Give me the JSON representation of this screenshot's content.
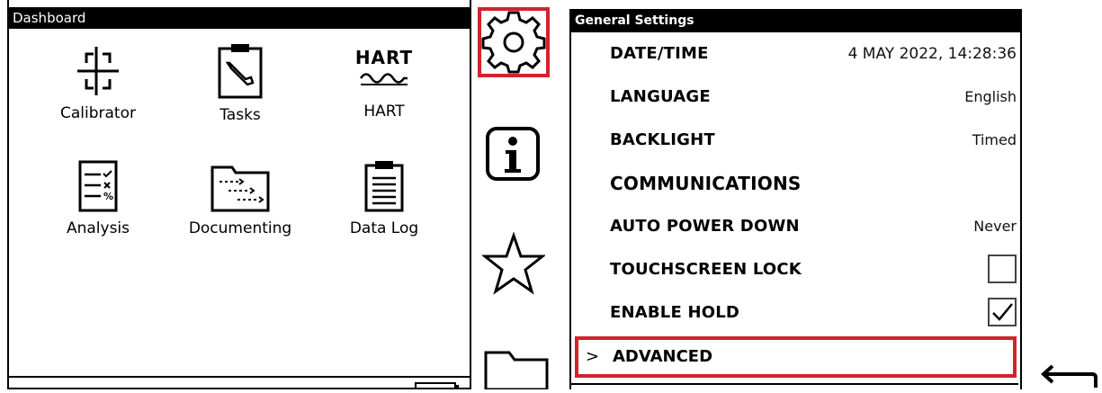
{
  "dashboard": {
    "title": "Dashboard",
    "apps": [
      {
        "label": "Calibrator",
        "icon": "crosshair-calibrator-icon"
      },
      {
        "label": "Tasks",
        "icon": "clipboard-wrench-icon"
      },
      {
        "label": "HART",
        "icon": "hart-wave-icon",
        "icon_text": "HART"
      },
      {
        "label": "Analysis",
        "icon": "analysis-list-icon"
      },
      {
        "label": "Documenting",
        "icon": "documenting-folder-icon"
      },
      {
        "label": "Data Log",
        "icon": "data-log-clipboard-icon"
      }
    ]
  },
  "side_strip": {
    "icons": [
      "settings-gear-icon",
      "info-icon",
      "favorites-star-icon",
      "folder-icon"
    ],
    "selected": "settings-gear-icon",
    "highlight_color": "#d0242b"
  },
  "general_settings": {
    "title": "General Settings",
    "rows": [
      {
        "label": "DATE/TIME",
        "value": "4 MAY 2022, 14:28:36"
      },
      {
        "label": "LANGUAGE",
        "value": "English"
      },
      {
        "label": "BACKLIGHT",
        "value": "Timed"
      },
      {
        "label": "COMMUNICATIONS",
        "value": ""
      },
      {
        "label": "AUTO POWER DOWN",
        "value": "Never"
      },
      {
        "label": "TOUCHSCREEN LOCK",
        "checked": false
      },
      {
        "label": "ENABLE HOLD",
        "checked": true
      }
    ],
    "advanced": {
      "label": "ADVANCED",
      "chevron": ">"
    }
  },
  "back_icon": "back-arrow-icon"
}
